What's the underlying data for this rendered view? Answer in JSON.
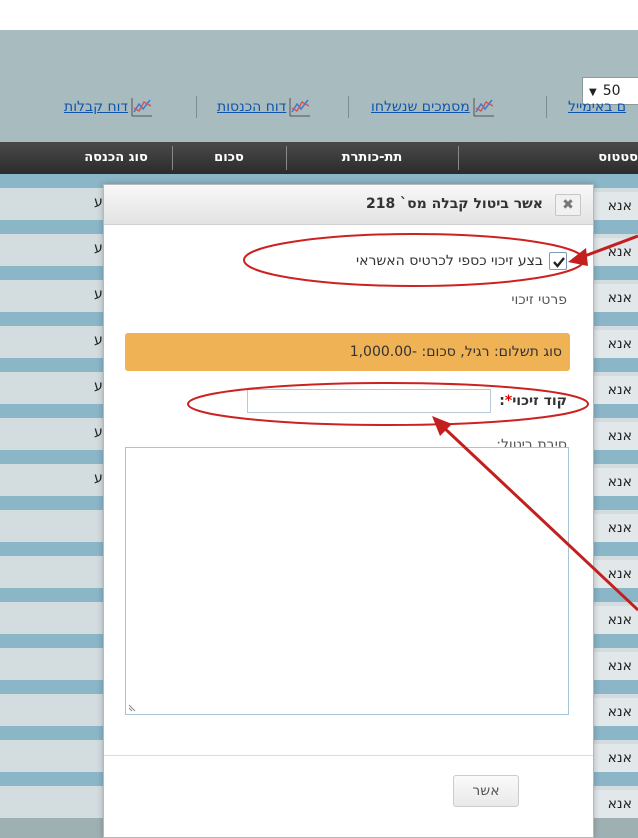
{
  "page_size_select": {
    "value": "50"
  },
  "report_links": [
    {
      "label": "דוח קבלות",
      "icon": "line-chart-icon"
    },
    {
      "label": "דוח הכנסות",
      "icon": "line-chart-icon"
    },
    {
      "label": "מסמכים שנשלחו",
      "icon": "line-chart-icon"
    },
    {
      "label": "ם באימייל",
      "icon": "line-chart-icon"
    }
  ],
  "grid": {
    "columns": {
      "income_type": "סוג הכנסה",
      "amount": "סכום",
      "subtitle": "תת-כותרת",
      "status": "סטטוס"
    },
    "row_status_text": "אנא",
    "row_type_text": "ע"
  },
  "dialog": {
    "title": "אשר ביטול קבלה מס` 218",
    "close_icon": "close-x-icon",
    "refund_checkbox_label": "בצע זיכוי כספי לכרטיס האשראי",
    "refund_checkbox_checked": true,
    "refund_details_label": "פרטי זיכוי",
    "payment_summary": "סוג תשלום: רגיל, סכום: -1,000.00",
    "refund_code_label": "קוד זיכוי",
    "refund_code_required_mark": "*",
    "refund_code_colon": ":",
    "refund_code_value": "",
    "reason_label": "סיבת ביטול:",
    "reason_value": "",
    "confirm_label": "אשר"
  },
  "colors": {
    "annotation_red": "#cc2222",
    "payment_bar": "#efb254",
    "header_dark": "#2b2b2b",
    "link_blue": "#1155aa"
  }
}
